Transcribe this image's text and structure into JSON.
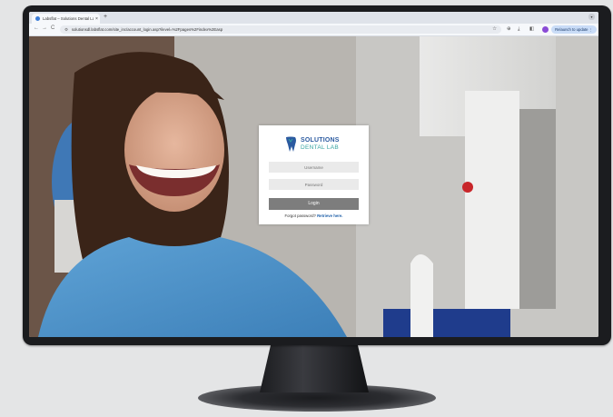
{
  "browser": {
    "tab_title": "Labsflat – Solutions Dental Lab",
    "tab_close": "×",
    "new_tab": "+",
    "tab_dropdown": "▾",
    "back": "←",
    "forward": "→",
    "reload": "C",
    "url": "solutionsdl.labsflat.com/site_inc/account_login.asp?ilevel=%2Fpages%2Findex%2Easp",
    "relaunch_label": "Relaunch to update ⋮",
    "icons": [
      "tune-icon",
      "star-icon",
      "extensions-icon",
      "download-icon",
      "sidepanel-icon",
      "profile-avatar"
    ]
  },
  "login": {
    "brand_line1": "SOLUTIONS",
    "brand_line2": "DENTAL LAB",
    "username_placeholder": "Username",
    "password_placeholder": "Password",
    "login_button": "Login",
    "forgot_text": "Forgot password?",
    "retrieve_link": "Retrieve here."
  },
  "colors": {
    "brand_blue": "#2b5aa0",
    "brand_teal": "#35a3a0",
    "button_gray": "#7d7d7d",
    "relaunch_bg": "#c9dcf7"
  }
}
